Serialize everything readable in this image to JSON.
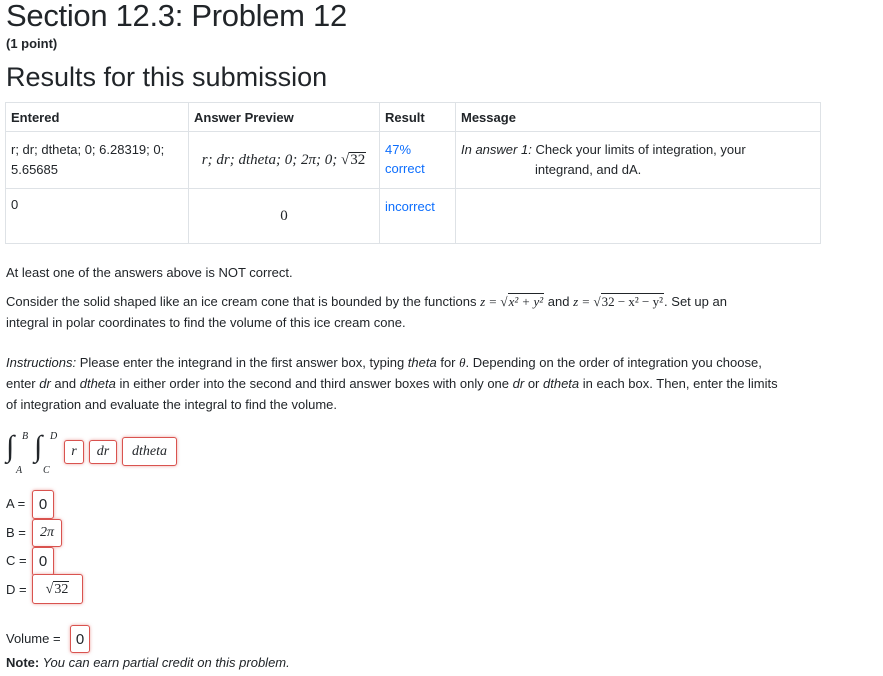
{
  "header": {
    "title": "Section 12.3: Problem 12",
    "points": "(1 point)",
    "results_heading": "Results for this submission"
  },
  "results_table": {
    "columns": [
      "Entered",
      "Answer Preview",
      "Result",
      "Message"
    ],
    "rows": [
      {
        "entered_line1": "r; dr; dtheta; 0; 6.28319; 0;",
        "entered_line2": "5.65685",
        "preview_prefix": "r; dr; dtheta; 0; 2π; 0; ",
        "preview_radicand": "32",
        "result_line1": "47%",
        "result_line2": "correct",
        "message_prefix": "In answer 1:",
        "message_line1": " Check your limits of integration, your",
        "message_line2": "integrand, and dA."
      },
      {
        "entered_line1": "0",
        "preview": "0",
        "result_line1": "incorrect"
      }
    ]
  },
  "problem": {
    "status": "At least one of the answers above is NOT correct.",
    "statement_a": "Consider the solid shaped like an ice cream cone that is bounded by the functions ",
    "func1_lhs": "z = ",
    "func1_radicand": "x² + y²",
    "statement_and": " and ",
    "func2_lhs": "z = ",
    "func2_radicand": "32 − x² − y²",
    "statement_b": ". Set up an",
    "statement_c": "integral in polar coordinates to find the volume of this ice cream cone.",
    "instructions_label": "Instructions:",
    "instructions_1": " Please enter the integrand in the first answer box, typing ",
    "instructions_theta": "theta",
    "instructions_2": " for ",
    "instructions_theta_symbol": "θ",
    "instructions_3": ". Depending on the order of integration you choose,",
    "instructions_4": "enter ",
    "instructions_dr": "dr",
    "instructions_5": " and ",
    "instructions_dtheta": "dtheta",
    "instructions_6": " in either order into the second and third answer boxes with only one ",
    "instructions_dr2": "dr",
    "instructions_7": " or ",
    "instructions_dtheta2": "dtheta",
    "instructions_8": " in each box. Then, enter the limits",
    "instructions_9": "of integration and evaluate the integral to find the volume."
  },
  "integral": {
    "sign": "∫",
    "upper_outer": "B",
    "lower_outer": "A",
    "upper_inner": "D",
    "lower_inner": "C",
    "box1": "r",
    "box2": "dr",
    "box3": "dtheta"
  },
  "limits": {
    "a_label": "A =",
    "a_value": "0",
    "b_label": "B =",
    "b_value": "2π",
    "c_label": "C =",
    "c_value": "0",
    "d_label": "D =",
    "d_radicand": "32",
    "volume_label": "Volume =",
    "volume_value": "0"
  },
  "note": {
    "label": "Note:",
    "text": " You can earn partial credit on this problem."
  }
}
